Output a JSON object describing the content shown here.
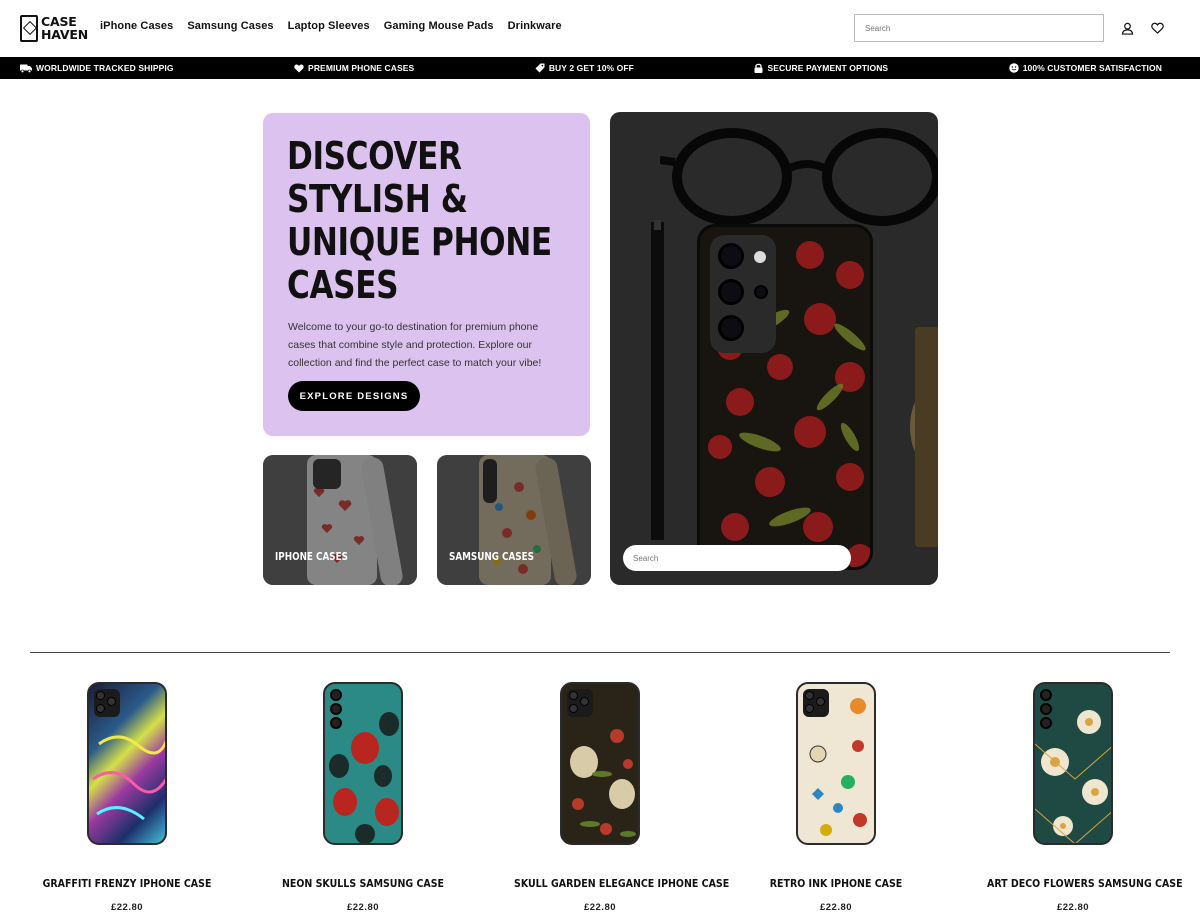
{
  "header": {
    "logo_line1": "CASE",
    "logo_line2": "HAVEN",
    "nav": [
      "iPhone Cases",
      "Samsung Cases",
      "Laptop Sleeves",
      "Gaming Mouse Pads",
      "Drinkware"
    ],
    "search_placeholder": "Search",
    "icons": [
      "account-icon",
      "wishlist-heart-icon"
    ]
  },
  "announcement": [
    {
      "icon": "truck-icon",
      "text": "WORLDWIDE TRACKED SHIPPIG"
    },
    {
      "icon": "heart-icon",
      "text": "PREMIUM PHONE CASES"
    },
    {
      "icon": "tag-icon",
      "text": "BUY 2 GET 10% OFF"
    },
    {
      "icon": "lock-icon",
      "text": "SECURE PAYMENT OPTIONS"
    },
    {
      "icon": "smile-icon",
      "text": "100% CUSTOMER SATISFACTION"
    }
  ],
  "hero": {
    "title": "Discover Stylish & Unique Phone Cases",
    "text": "Welcome to your go-to destination for premium phone cases that combine style and protection. Explore our collection and find the perfect case to match your vibe!",
    "button": "Explore Designs",
    "tiles": [
      "iPhone Cases",
      "Samsung Cases"
    ],
    "photo_search_placeholder": "Search",
    "accent": "#dcc3ef"
  },
  "products": [
    {
      "title": "Graffiti Frenzy iPhone Case",
      "price": "£22.80"
    },
    {
      "title": "Neon Skulls Samsung Case",
      "price": "£22.80"
    },
    {
      "title": "Skull Garden Elegance iPhone Case",
      "price": "£22.80"
    },
    {
      "title": "Retro Ink iPhone Case",
      "price": "£22.80"
    },
    {
      "title": "Art Deco Flowers Samsung Case",
      "price": "£22.80"
    }
  ]
}
